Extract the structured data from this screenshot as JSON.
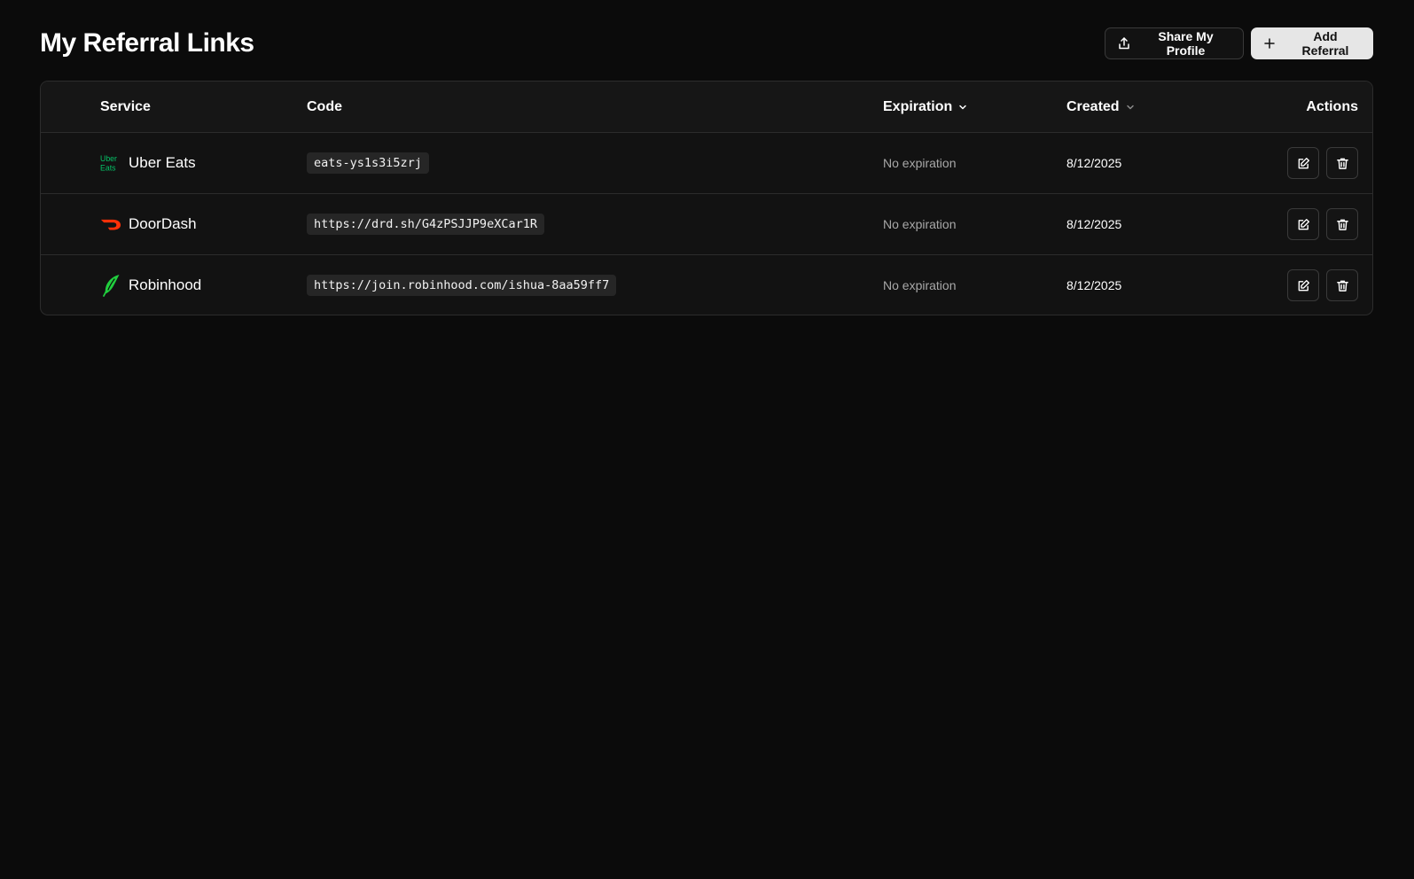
{
  "page": {
    "title": "My Referral Links"
  },
  "toolbar": {
    "share_label": "Share My Profile",
    "share_icon": "share-upload-icon",
    "add_label": "Add Referral",
    "add_icon": "plus-icon"
  },
  "table": {
    "columns": {
      "service": "Service",
      "code": "Code",
      "expiration": "Expiration",
      "created": "Created",
      "actions": "Actions"
    },
    "rows": [
      {
        "service": "Uber Eats",
        "logo": "uber-eats-logo",
        "logo_text_top": "Uber",
        "logo_text_bottom": "Eats",
        "code": "eats-ys1s3i5zrj",
        "expiration": "No expiration",
        "created": "8/12/2025"
      },
      {
        "service": "DoorDash",
        "logo": "doordash-logo",
        "code": "https://drd.sh/G4zPSJJP9eXCar1R",
        "expiration": "No expiration",
        "created": "8/12/2025"
      },
      {
        "service": "Robinhood",
        "logo": "robinhood-logo",
        "code": "https://join.robinhood.com/ishua-8aa59ff7",
        "expiration": "No expiration",
        "created": "8/12/2025"
      }
    ]
  },
  "colors": {
    "background": "#0b0b0b",
    "card": "#121212",
    "border": "#2c2c2c",
    "uber_green": "#06c167",
    "doordash_red": "#ff3008",
    "robinhood_green": "#21ce3e"
  }
}
